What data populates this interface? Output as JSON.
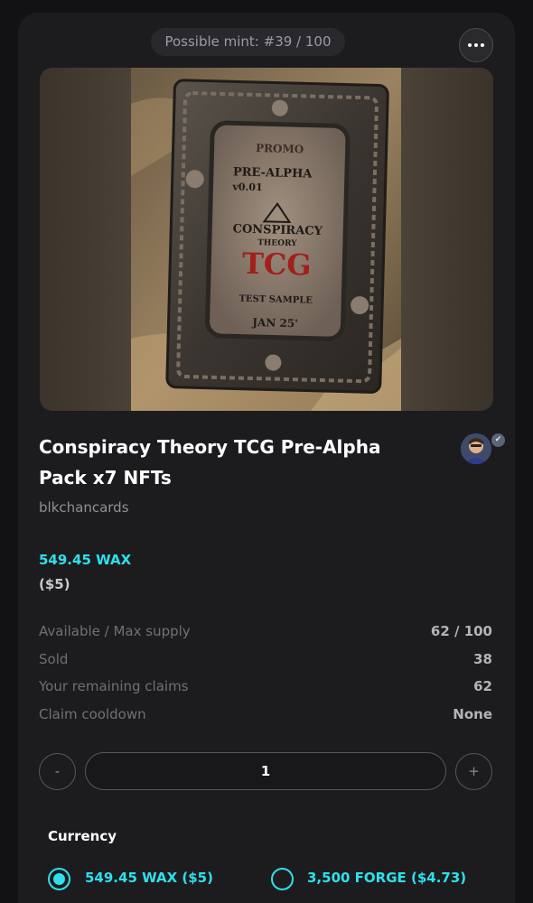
{
  "mint_badge": "Possible mint: #39 / 100",
  "image": {
    "card_lines": [
      "PROMO",
      "PRE-ALPHA",
      "v0.01",
      "CONSPIRACY",
      "THEORY",
      "TCG",
      "TEST SAMPLE",
      "JAN 25'"
    ]
  },
  "title": "Conspiracy Theory TCG Pre-Alpha Pack x7 NFTs",
  "creator": "blkchancards",
  "price": {
    "wax": "549.45 WAX",
    "usd": "($5)"
  },
  "stats": [
    {
      "label": "Available / Max supply",
      "value": "62 / 100"
    },
    {
      "label": "Sold",
      "value": "38"
    },
    {
      "label": "Your remaining claims",
      "value": "62"
    },
    {
      "label": "Claim cooldown",
      "value": "None"
    }
  ],
  "quantity": {
    "minus": "-",
    "value": "1",
    "plus": "+"
  },
  "currency": {
    "label": "Currency",
    "options": [
      {
        "label": "549.45 WAX ($5)",
        "selected": true
      },
      {
        "label": "3,500 FORGE ($4.73)",
        "selected": false
      }
    ]
  },
  "colors": {
    "accent": "#2fe0ea",
    "background": "#121214",
    "card": "#1c1c1f"
  }
}
